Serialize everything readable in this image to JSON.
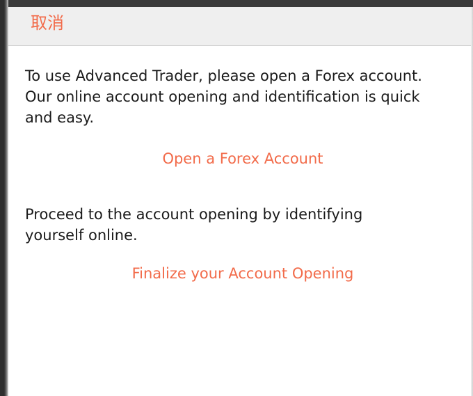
{
  "header": {
    "cancel_label": "取消"
  },
  "main": {
    "intro_text": "To use Advanced Trader, please open a Forex account. Our online account opening and identification is quick and easy.",
    "open_account_link": "Open a Forex Account",
    "proceed_text": "Proceed to the account opening by identifying yourself online.",
    "finalize_link": "Finalize your Account Opening"
  },
  "colors": {
    "accent": "#f26b4a",
    "header_bg": "#efefef",
    "text": "#1a1a1a"
  }
}
